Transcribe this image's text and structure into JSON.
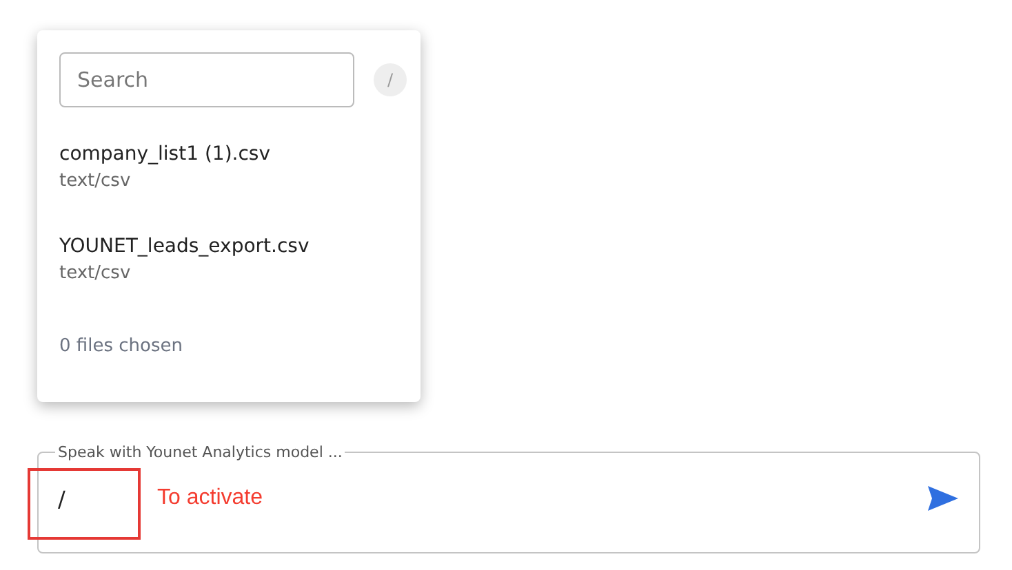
{
  "file_picker": {
    "search": {
      "placeholder": "Search"
    },
    "shortcut_badge": "/",
    "files": [
      {
        "name": "company_list1 (1).csv",
        "type": "text/csv"
      },
      {
        "name": "YOUNET_leads_export.csv",
        "type": "text/csv"
      }
    ],
    "status": "0 files chosen"
  },
  "chat_input": {
    "label": "Speak with Younet Analytics model ...",
    "value": "/"
  },
  "annotation": {
    "text": "To activate"
  }
}
